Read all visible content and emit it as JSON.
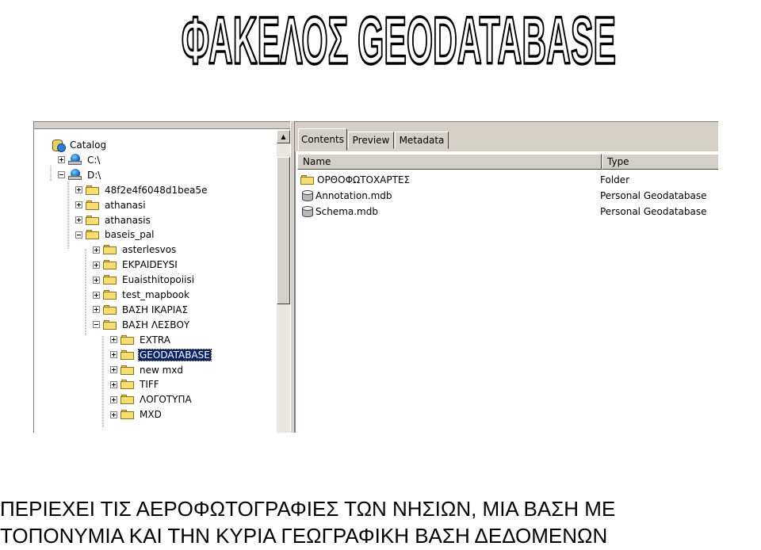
{
  "heading": "ΦΑΚΕΛΟΣ GEODATABASE",
  "tree": {
    "nodes": [
      {
        "label": "Catalog",
        "icon": "catalog-icon",
        "expander": "none",
        "selected": false
      },
      {
        "label": "C:\\",
        "icon": "drive-icon",
        "expander": "plus",
        "selected": false
      },
      {
        "label": "D:\\",
        "icon": "drive-icon",
        "expander": "minus",
        "selected": false
      },
      {
        "label": "48f2e4f6048d1bea5e",
        "icon": "folder-icon",
        "expander": "plus",
        "selected": false
      },
      {
        "label": "athanasi",
        "icon": "folder-icon",
        "expander": "plus",
        "selected": false
      },
      {
        "label": "athanasis",
        "icon": "folder-icon",
        "expander": "plus",
        "selected": false
      },
      {
        "label": "baseis_pal",
        "icon": "folder-icon",
        "expander": "minus",
        "selected": false
      },
      {
        "label": "asterlesvos",
        "icon": "folder-icon",
        "expander": "plus",
        "selected": false
      },
      {
        "label": "ΕΚΡΑΙDEYSI",
        "icon": "folder-icon",
        "expander": "plus",
        "selected": false
      },
      {
        "label": "Euaisthitopoiisi",
        "icon": "folder-icon",
        "expander": "plus",
        "selected": false
      },
      {
        "label": "test_mapbook",
        "icon": "folder-icon",
        "expander": "plus",
        "selected": false
      },
      {
        "label": "ΒΑΣΗ ΙΚΑΡΙΑΣ",
        "icon": "folder-icon",
        "expander": "plus",
        "selected": false
      },
      {
        "label": "ΒΑΣΗ ΛΕΣΒΟΥ",
        "icon": "folder-icon",
        "expander": "minus",
        "selected": false
      },
      {
        "label": "EXTRA",
        "icon": "folder-icon",
        "expander": "plus",
        "selected": false
      },
      {
        "label": "GEODATABASE",
        "icon": "folder-icon",
        "expander": "plus",
        "selected": true
      },
      {
        "label": "new mxd",
        "icon": "folder-icon",
        "expander": "plus",
        "selected": false
      },
      {
        "label": "TIFF",
        "icon": "folder-icon",
        "expander": "plus",
        "selected": false
      },
      {
        "label": "ΛΟΓΟΤΥΠΑ",
        "icon": "folder-icon",
        "expander": "plus",
        "selected": false
      },
      {
        "label": "MXD",
        "icon": "folder-icon",
        "expander": "plus",
        "selected": false
      }
    ]
  },
  "tabs": [
    {
      "label": "Contents",
      "active": true
    },
    {
      "label": "Preview",
      "active": false
    },
    {
      "label": "Metadata",
      "active": false
    }
  ],
  "columns": {
    "name": "Name",
    "type": "Type"
  },
  "files": [
    {
      "name": "ΟΡΘΟΦΩΤΟΧΑΡΤΕΣ",
      "type": "Folder",
      "icon": "folder-icon"
    },
    {
      "name": "Annotation.mdb",
      "type": "Personal Geodatabase",
      "icon": "database-icon"
    },
    {
      "name": "Schema.mdb",
      "type": "Personal Geodatabase",
      "icon": "database-icon"
    }
  ],
  "caption": {
    "line1": "ΠΕΡΙΕΧΕΙ ΤΙΣ ΑΕΡΟΦΩΤΟΓΡΑΦΙΕΣ ΤΩΝ ΝΗΣΙΩΝ, ΜΙΑ ΒΑΣΗ ΜΕ",
    "line2": "ΤΟΠΟΝΥΜΙΑ ΚΑΙ ΤΗΝ ΚΥΡΙΑ ΓΕΩΓΡΑΦΙΚΗ ΒΑΣΗ ΔΕΔΟΜΕΝΩΝ"
  },
  "colors": {
    "selection": "#0a246a",
    "chrome": "#d4d0c8",
    "folder": "#f7dc6f"
  }
}
